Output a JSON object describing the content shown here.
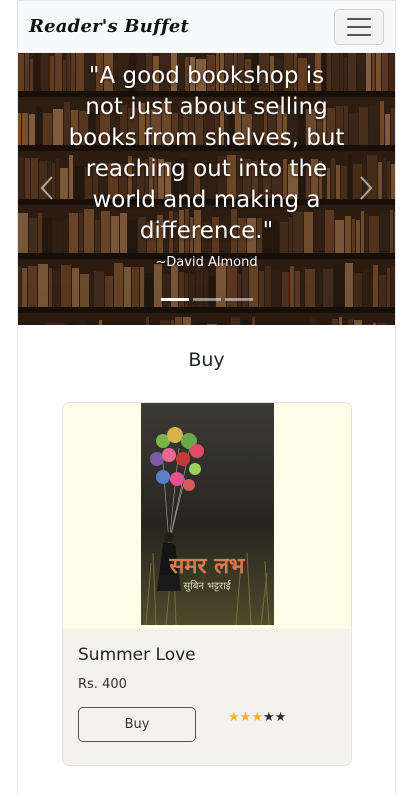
{
  "navbar": {
    "brand": "Reader's Buffet",
    "menu_icon": "hamburger-menu-icon"
  },
  "carousel": {
    "quote": "\"A good bookshop is not just about selling books from shelves, but reaching out into the world and making a difference.\"",
    "author": "~David Almond",
    "slide_count": 3,
    "active_slide": 1,
    "prev_icon": "chevron-left-icon",
    "next_icon": "chevron-right-icon"
  },
  "section": {
    "title": "Buy"
  },
  "book": {
    "title": "Summer Love",
    "price": "Rs. 400",
    "buy_label": "Buy",
    "rating": 3,
    "rating_max": 5,
    "cover_text_line1": "समर लभ",
    "cover_text_line2": "सुबिन भट्टराई"
  },
  "colors": {
    "navbar_bg": "#f8f9fa",
    "star_on": "#f3b324",
    "star_off": "#2b2b2b",
    "card_bg": "#f4f2ec",
    "card_image_bg": "#fefde7"
  }
}
